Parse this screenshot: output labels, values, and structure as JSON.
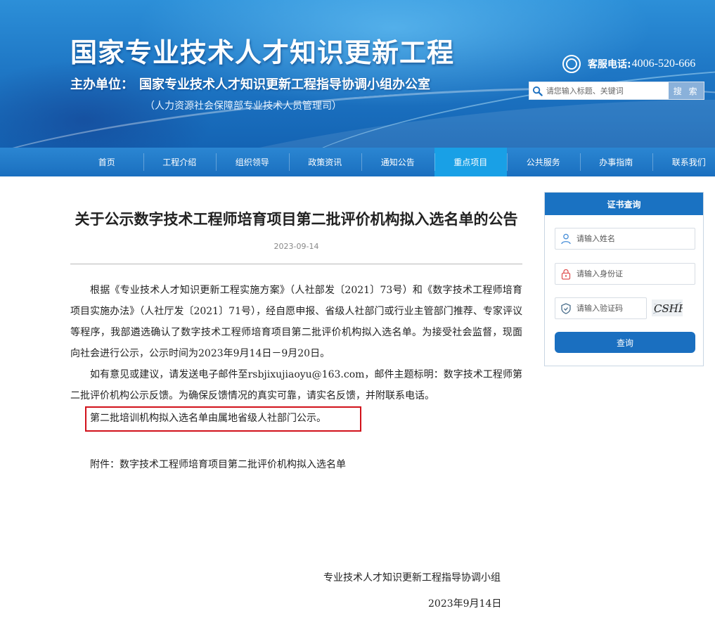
{
  "header": {
    "site_title": "国家专业技术人才知识更新工程",
    "host_label": "主办单位：",
    "host_name": "国家专业技术人才知识更新工程指导协调小组办公室",
    "sub_host": "（人力资源社会保障部专业技术人员管理司）",
    "hotline_label": "客服电话:",
    "hotline_number": "4006-520-666",
    "search_placeholder": "请您输入标题、关键词",
    "search_button": "搜 索"
  },
  "nav": {
    "items": [
      {
        "label": "首页"
      },
      {
        "label": "工程介绍"
      },
      {
        "label": "组织领导"
      },
      {
        "label": "政策资讯"
      },
      {
        "label": "通知公告"
      },
      {
        "label": "重点项目",
        "active": true
      },
      {
        "label": "公共服务"
      },
      {
        "label": "办事指南"
      },
      {
        "label": "联系我们"
      }
    ]
  },
  "article": {
    "title": "关于公示数字技术工程师培育项目第二批评价机构拟入选名单的公告",
    "date": "2023-09-14",
    "paragraphs": [
      "根据《专业技术人才知识更新工程实施方案》（人社部发〔2021〕73号）和《数字技术工程师培育项目实施办法》（人社厅发〔2021〕71号），经自愿申报、省级人社部门或行业主管部门推荐、专家评议等程序，我部遴选确认了数字技术工程师培育项目第二批评价机构拟入选名单。为接受社会监督，现面向社会进行公示，公示时间为2023年9月14日－9月20日。",
      "如有意见或建议，请发送电子邮件至rsbjixujiaoyu@163.com，邮件主题标明：数字技术工程师第二批评价机构公示反馈。为确保反馈情况的真实可靠，请实名反馈，并附联系电话。"
    ],
    "highlight": "第二批培训机构拟入选名单由属地省级人社部门公示。",
    "attachment": "附件：数字技术工程师培育项目第二批评价机构拟入选名单",
    "signature_org": "专业技术人才知识更新工程指导协调小组",
    "signature_date": "2023年9月14日"
  },
  "cert": {
    "title": "证书查询",
    "name_placeholder": "请输入姓名",
    "id_placeholder": "请输入身份证",
    "captcha_placeholder": "请输入验证码",
    "captcha_text": "CSHF",
    "query_button": "查询"
  },
  "colors": {
    "nav_bg": "#1a6fbf",
    "nav_active": "#19a0e6",
    "highlight_border": "#d1121b",
    "button_blue": "#1a6fc0"
  }
}
